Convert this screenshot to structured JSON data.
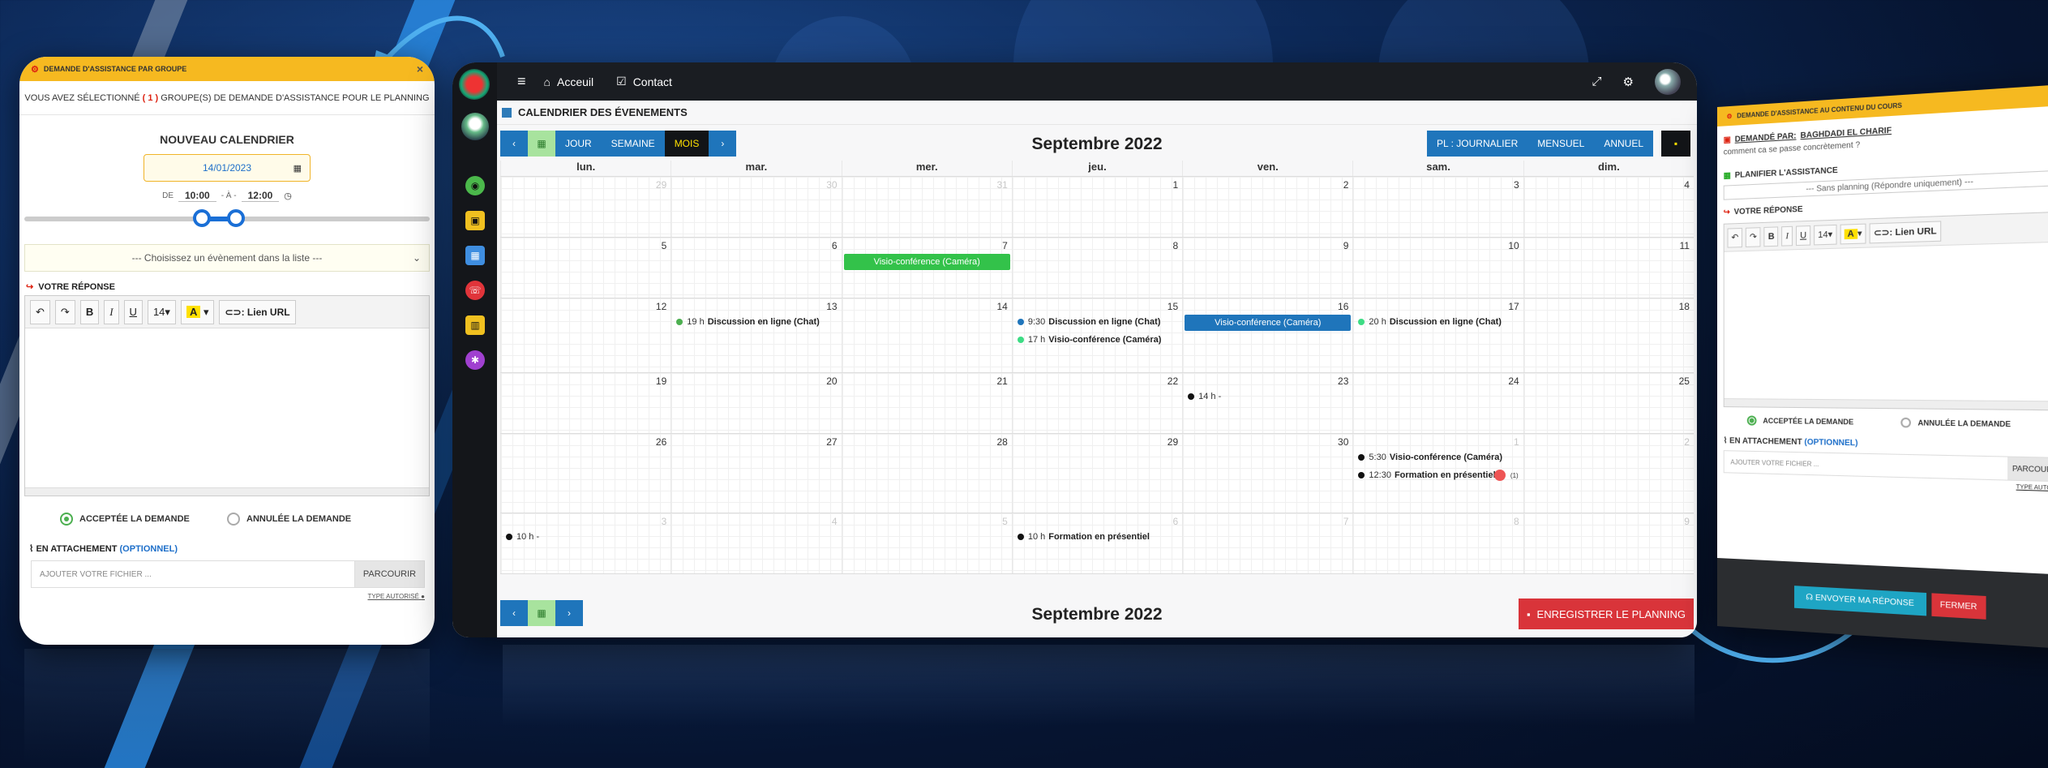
{
  "colors": {
    "accent": "#1f75bb",
    "header_yellow": "#f6b920",
    "save_red": "#d9343a",
    "dark": "#121417",
    "event_green": "#33c24a",
    "event_blue": "#1f75bb"
  },
  "left_panel": {
    "header_title": "DEMANDE D'ASSISTANCE PAR GROUPE",
    "info_prefix": "VOUS AVEZ SÉLECTIONNÉ",
    "info_count": "( 1 )",
    "info_suffix": "GROUPE(S) DE DEMANDE D'ASSISTANCE POUR LE PLANNING",
    "new_calendar_title": "NOUVEAU CALENDRIER",
    "date_value": "14/01/2023",
    "time_from_label": "DE",
    "time_from": "10:00",
    "time_to_label": "- À -",
    "time_to": "12:00",
    "event_select_placeholder": "--- Choisissez un évènement dans la liste ---",
    "reply_label": "VOTRE RÉPONSE",
    "font_size": "14",
    "link_label": "Lien URL",
    "accept_label": "ACCEPTÉE LA DEMANDE",
    "cancel_label": "ANNULÉE LA DEMANDE",
    "attachment_label": "EN ATTACHEMENT",
    "attachment_optional": "(OPTIONNEL)",
    "file_placeholder": "AJOUTER VOTRE FICHIER ...",
    "browse_label": "PARCOURIR",
    "allowed_types": "TYPE AUTORISÉ"
  },
  "topbar": {
    "nav": [
      {
        "label": "Acceuil",
        "icon": "home-icon"
      },
      {
        "label": "Contact",
        "icon": "contact-icon"
      }
    ]
  },
  "calendar": {
    "section_title": "CALENDRIER DES ÉVENEMENTS",
    "month_title": "Septembre 2022",
    "view_buttons": [
      "JOUR",
      "SEMAINE",
      "MOIS"
    ],
    "active_view": "MOIS",
    "plan_buttons": [
      "PL : JOURNALIER",
      "MENSUEL",
      "ANNUEL"
    ],
    "days_of_week": [
      "lun.",
      "mar.",
      "mer.",
      "jeu.",
      "ven.",
      "sam.",
      "dim."
    ],
    "weeks": [
      [
        {
          "n": "29",
          "o": true
        },
        {
          "n": "30",
          "o": true
        },
        {
          "n": "31",
          "o": true
        },
        {
          "n": "1"
        },
        {
          "n": "2"
        },
        {
          "n": "3"
        },
        {
          "n": "4"
        }
      ],
      [
        {
          "n": "5"
        },
        {
          "n": "6"
        },
        {
          "n": "7",
          "events": [
            {
              "bar": true,
              "color": "#33c24a",
              "name": "Visio-conférence (Caméra)"
            }
          ]
        },
        {
          "n": "8"
        },
        {
          "n": "9"
        },
        {
          "n": "10"
        },
        {
          "n": "11"
        }
      ],
      [
        {
          "n": "12"
        },
        {
          "n": "13",
          "events": [
            {
              "dot": "#4caf50",
              "time": "19 h",
              "name": "Discussion en ligne (Chat)"
            }
          ]
        },
        {
          "n": "14"
        },
        {
          "n": "15",
          "events": [
            {
              "dot": "#1f75bb",
              "time": "9:30",
              "name": "Discussion en ligne (Chat)"
            },
            {
              "dot": "#3ddc84",
              "time": "17 h",
              "name": "Visio-conférence (Caméra)"
            }
          ]
        },
        {
          "n": "16",
          "events": [
            {
              "bar": true,
              "color": "#1f75bb",
              "name": "Visio-conférence (Caméra)"
            }
          ]
        },
        {
          "n": "17",
          "events": [
            {
              "dot": "#3ddc84",
              "time": "20 h",
              "name": "Discussion en ligne (Chat)"
            }
          ]
        },
        {
          "n": "18"
        }
      ],
      [
        {
          "n": "19"
        },
        {
          "n": "20"
        },
        {
          "n": "21"
        },
        {
          "n": "22"
        },
        {
          "n": "23",
          "events": [
            {
              "dot": "#111",
              "time": "14 h -",
              "name": ""
            }
          ]
        },
        {
          "n": "24"
        },
        {
          "n": "25"
        }
      ],
      [
        {
          "n": "26"
        },
        {
          "n": "27"
        },
        {
          "n": "28"
        },
        {
          "n": "29"
        },
        {
          "n": "30"
        },
        {
          "n": "1",
          "o": true,
          "events": [
            {
              "dot": "#111",
              "time": "5:30",
              "name": "Visio-conférence (Caméra)"
            },
            {
              "dot": "#111",
              "time": "12:30",
              "name": "Formation en présentiel"
            }
          ]
        },
        {
          "n": "2",
          "o": true
        }
      ],
      [
        {
          "n": "3",
          "o": true,
          "events": [
            {
              "dot": "#111",
              "time": "10 h -",
              "name": ""
            }
          ]
        },
        {
          "n": "4",
          "o": true
        },
        {
          "n": "5",
          "o": true
        },
        {
          "n": "6",
          "o": true,
          "events": [
            {
              "dot": "#111",
              "time": "10 h",
              "name": "Formation en présentiel"
            }
          ]
        },
        {
          "n": "7",
          "o": true
        },
        {
          "n": "8",
          "o": true
        },
        {
          "n": "9",
          "o": true
        }
      ]
    ],
    "more_badge": "(1)",
    "save_button": "ENREGISTRER LE PLANNING"
  },
  "right_panel": {
    "header_title": "DEMANDE D'ASSISTANCE AU CONTENU DU COURS",
    "requested_by_label": "DEMANDÉ PAR:",
    "requested_by": "BAGHDADI EL CHARIF",
    "message": "comment ca se passe concrètement ?",
    "plan_label": "PLANIFIER L'ASSISTANCE",
    "plan_select": "--- Sans planning (Répondre uniquement) ---",
    "reply_label": "VOTRE RÉPONSE",
    "font_size": "14",
    "link_label": "Lien URL",
    "accept_label": "ACCEPTÉE LA DEMANDE",
    "cancel_label": "ANNULÉE LA DEMANDE",
    "attachment_label": "EN ATTACHEMENT",
    "attachment_optional": "(OPTIONNEL)",
    "file_placeholder": "AJOUTER VOTRE FICHIER ...",
    "browse_label": "PARCOURIR",
    "allowed_types": "TYPE AUTORISÉ",
    "send_button": "ENVOYER MA RÉPONSE",
    "close_button": "FERMER"
  }
}
